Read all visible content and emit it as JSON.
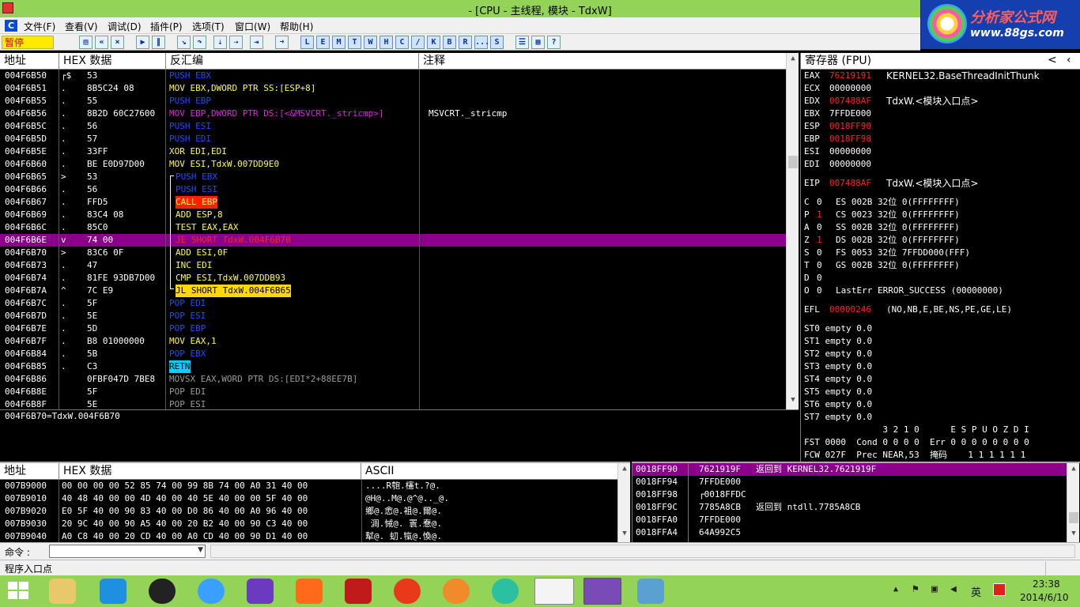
{
  "window": {
    "title": "- [CPU - 主线程, 模块 - TdxW]"
  },
  "logo": {
    "line1": "分析家公式网",
    "line2": "www.88gs.com"
  },
  "menu": [
    "文件(F)",
    "查看(V)",
    "调试(D)",
    "插件(P)",
    "选项(T)",
    "窗口(W)",
    "帮助(H)"
  ],
  "toolbar": {
    "pause": "暂停",
    "letters": [
      "L",
      "E",
      "M",
      "T",
      "W",
      "H",
      "C",
      "/",
      "K",
      "B",
      "R",
      "...",
      "S"
    ]
  },
  "disasm": {
    "headers": [
      "地址",
      "HEX 数据",
      "反汇编",
      "注释"
    ],
    "rows": [
      {
        "addr": "004F6B50",
        "mark": "┌$",
        "hex": "53",
        "asm": "PUSH EBX",
        "cls": "blue",
        "cmt": ""
      },
      {
        "addr": "004F6B51",
        "mark": ".",
        "hex": "8B5C24 08",
        "asm": "MOV EBX,DWORD PTR SS:[ESP+8]",
        "cls": "yel",
        "cmt": ""
      },
      {
        "addr": "004F6B55",
        "mark": ".",
        "hex": "55",
        "asm": "PUSH EBP",
        "cls": "blue",
        "cmt": ""
      },
      {
        "addr": "004F6B56",
        "mark": ".",
        "hex": "8B2D 60C27600",
        "asm": "MOV EBP,DWORD PTR DS:[<&MSVCRT._stricmp>]",
        "cls": "mag",
        "cmt": "MSVCRT._stricmp"
      },
      {
        "addr": "004F6B5C",
        "mark": ".",
        "hex": "56",
        "asm": "PUSH ESI",
        "cls": "blue",
        "cmt": ""
      },
      {
        "addr": "004F6B5D",
        "mark": ".",
        "hex": "57",
        "asm": "PUSH EDI",
        "cls": "blue",
        "cmt": ""
      },
      {
        "addr": "004F6B5E",
        "mark": ".",
        "hex": "33FF",
        "asm": "XOR EDI,EDI",
        "cls": "yel",
        "cmt": ""
      },
      {
        "addr": "004F6B60",
        "mark": ".",
        "hex": "BE E0D97D00",
        "asm": "MOV ESI,TdxW.007DD9E0",
        "cls": "yel",
        "cmt": ""
      },
      {
        "addr": "004F6B65",
        "mark": ">",
        "hex": "53",
        "asm": "PUSH EBX",
        "cls": "blue",
        "cmt": ""
      },
      {
        "addr": "004F6B66",
        "mark": ".",
        "hex": "56",
        "asm": "PUSH ESI",
        "cls": "blue",
        "cmt": ""
      },
      {
        "addr": "004F6B67",
        "mark": ".",
        "hex": "FFD5",
        "asm": "CALL EBP",
        "cls": "call",
        "cmt": ""
      },
      {
        "addr": "004F6B69",
        "mark": ".",
        "hex": "83C4 08",
        "asm": "ADD ESP,8",
        "cls": "yel",
        "cmt": ""
      },
      {
        "addr": "004F6B6C",
        "mark": ".",
        "hex": "85C0",
        "asm": "TEST EAX,EAX",
        "cls": "yel",
        "cmt": ""
      },
      {
        "addr": "004F6B6E",
        "mark": "v",
        "hex": "74 00",
        "asm": "JE SHORT TdxW.004F6B70",
        "cls": "sel",
        "cmt": ""
      },
      {
        "addr": "004F6B70",
        "mark": ">",
        "hex": "83C6 0F",
        "asm": "ADD ESI,0F",
        "cls": "yel",
        "cmt": ""
      },
      {
        "addr": "004F6B73",
        "mark": ".",
        "hex": "47",
        "asm": "INC EDI",
        "cls": "yel",
        "cmt": ""
      },
      {
        "addr": "004F6B74",
        "mark": ".",
        "hex": "81FE 93DB7D00",
        "asm": "CMP ESI,TdxW.007DDB93",
        "cls": "yel",
        "cmt": ""
      },
      {
        "addr": "004F6B7A",
        "mark": "^",
        "hex": "7C E9",
        "asm": "JL SHORT TdxW.004F6B65",
        "cls": "jl",
        "cmt": ""
      },
      {
        "addr": "004F6B7C",
        "mark": ".",
        "hex": "5F",
        "asm": "POP EDI",
        "cls": "blue",
        "cmt": ""
      },
      {
        "addr": "004F6B7D",
        "mark": ".",
        "hex": "5E",
        "asm": "POP ESI",
        "cls": "blue",
        "cmt": ""
      },
      {
        "addr": "004F6B7E",
        "mark": ".",
        "hex": "5D",
        "asm": "POP EBP",
        "cls": "blue",
        "cmt": ""
      },
      {
        "addr": "004F6B7F",
        "mark": ".",
        "hex": "B8 01000000",
        "asm": "MOV EAX,1",
        "cls": "yel",
        "cmt": ""
      },
      {
        "addr": "004F6B84",
        "mark": ".",
        "hex": "5B",
        "asm": "POP EBX",
        "cls": "blue",
        "cmt": ""
      },
      {
        "addr": "004F6B85",
        "mark": ".",
        "hex": "C3",
        "asm": "RETN",
        "cls": "retn",
        "cmt": ""
      },
      {
        "addr": "004F6B86",
        "mark": "",
        "hex": "0FBF047D 7BE8",
        "asm": "MOVSX EAX,WORD PTR DS:[EDI*2+88EE7B]",
        "cls": "grey",
        "cmt": ""
      },
      {
        "addr": "004F6B8E",
        "mark": "",
        "hex": "5F",
        "asm": "POP EDI",
        "cls": "grey",
        "cmt": ""
      },
      {
        "addr": "004F6B8F",
        "mark": "",
        "hex": "5E",
        "asm": "POP ESI",
        "cls": "grey",
        "cmt": ""
      }
    ],
    "info": "004F6B70=TdxW.004F6B70"
  },
  "registers": {
    "header": "寄存器 (FPU)",
    "gp": [
      {
        "name": "EAX",
        "val": "76219191",
        "red": true,
        "note": "KERNEL32.BaseThreadInitThunk"
      },
      {
        "name": "ECX",
        "val": "00000000",
        "red": false,
        "note": ""
      },
      {
        "name": "EDX",
        "val": "007488AF",
        "red": true,
        "note": "TdxW.<模块入口点>"
      },
      {
        "name": "EBX",
        "val": "7FFDE000",
        "red": false,
        "note": ""
      },
      {
        "name": "ESP",
        "val": "0018FF90",
        "red": true,
        "note": ""
      },
      {
        "name": "EBP",
        "val": "0018FF98",
        "red": true,
        "note": ""
      },
      {
        "name": "ESI",
        "val": "00000000",
        "red": false,
        "note": ""
      },
      {
        "name": "EDI",
        "val": "00000000",
        "red": false,
        "note": ""
      }
    ],
    "eip": {
      "name": "EIP",
      "val": "007488AF",
      "note": "TdxW.<模块入口点>"
    },
    "flags": [
      {
        "f": "C",
        "v": "0",
        "red": false,
        "seg": "ES 002B 32位 0(FFFFFFFF)"
      },
      {
        "f": "P",
        "v": "1",
        "red": true,
        "seg": "CS 0023 32位 0(FFFFFFFF)"
      },
      {
        "f": "A",
        "v": "0",
        "red": false,
        "seg": "SS 002B 32位 0(FFFFFFFF)"
      },
      {
        "f": "Z",
        "v": "1",
        "red": true,
        "seg": "DS 002B 32位 0(FFFFFFFF)"
      },
      {
        "f": "S",
        "v": "0",
        "red": false,
        "seg": "FS 0053 32位 7FFDD000(FFF)"
      },
      {
        "f": "T",
        "v": "0",
        "red": false,
        "seg": "GS 002B 32位 0(FFFFFFFF)"
      },
      {
        "f": "D",
        "v": "0",
        "red": false,
        "seg": ""
      },
      {
        "f": "O",
        "v": "0",
        "red": false,
        "seg": "LastErr ERROR_SUCCESS (00000000)"
      }
    ],
    "efl": {
      "val": "00000246",
      "desc": "(NO,NB,E,BE,NS,PE,GE,LE)"
    },
    "st": [
      "ST0 empty 0.0",
      "ST1 empty 0.0",
      "ST2 empty 0.0",
      "ST3 empty 0.0",
      "ST4 empty 0.0",
      "ST5 empty 0.0",
      "ST6 empty 0.0",
      "ST7 empty 0.0"
    ],
    "fpu1": "               3 2 1 0      E S P U O Z D I",
    "fpu2": "FST 0000  Cond 0 0 0 0  Err 0 0 0 0 0 0 0 0",
    "fpu3": "FCW 027F  Prec NEAR,53  掩码    1 1 1 1 1 1"
  },
  "dump": {
    "headers": [
      "地址",
      "HEX 数据",
      "ASCII"
    ],
    "rows": [
      {
        "addr": "007B9000",
        "hex": "00 00 00 00 52 85 74 00 99 8B 74 00 A0 31 40 00",
        "ascii": "....R匏.櫶t.?@."
      },
      {
        "addr": "007B9010",
        "hex": "40 48 40 00 00 4D 40 00 40 5E 40 00 00 5F 40 00",
        "ascii": "@H@..M@.@^@.._@."
      },
      {
        "addr": "007B9020",
        "hex": "E0 5F 40 00 90 83 40 00 D0 86 40 00 A0 96 40 00",
        "ascii": "鄉@.悆@.袓@.爾@."
      },
      {
        "addr": "007B9030",
        "hex": "20 9C 40 00 90 A5 40 00 20 B2 40 00 90 C3 40 00",
        "ascii": " 淍.悈@. 瞏.惷@."
      },
      {
        "addr": "007B9040",
        "hex": "A0 C8 40 00 20 CD 40 00 A0 CD 40 00 90 D1 40 00",
        "ascii": "犎@. 虭.犔@.愌@."
      }
    ]
  },
  "stack": {
    "rows": [
      {
        "addr": "0018FF90",
        "val": "7621919F",
        "cmt": "返回到 KERNEL32.7621919F",
        "sel": true
      },
      {
        "addr": "0018FF94",
        "val": "7FFDE000",
        "cmt": "",
        "sel": false
      },
      {
        "addr": "0018FF98",
        "val": "┌0018FFDC",
        "cmt": "",
        "sel": false
      },
      {
        "addr": "0018FF9C",
        "val": "7785A8CB",
        "cmt": "返回到 ntdll.7785A8CB",
        "sel": false
      },
      {
        "addr": "0018FFA0",
        "val": "7FFDE000",
        "cmt": "",
        "sel": false
      },
      {
        "addr": "0018FFA4",
        "val": "64A992C5",
        "cmt": "",
        "sel": false
      }
    ]
  },
  "command": {
    "label": "命令 :",
    "value": ""
  },
  "status": {
    "text": "程序入口点"
  },
  "clock": {
    "time": "23:38",
    "date": "2014/6/10",
    "ime": "英"
  }
}
